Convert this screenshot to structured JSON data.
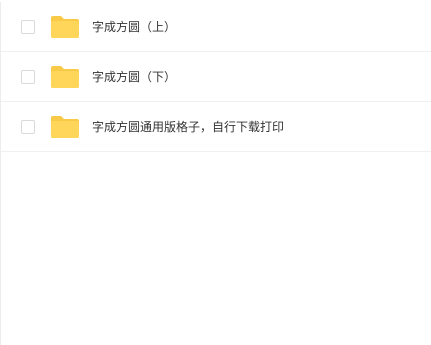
{
  "colors": {
    "folder_back": "#F9C948",
    "folder_front": "#FFD659",
    "row_divider": "#F0F0F0",
    "checkbox_border": "#D9D9D9",
    "text": "#333333"
  },
  "files": [
    {
      "name": "字成方圆（上）",
      "icon": "folder-icon",
      "checked": false
    },
    {
      "name": "字成方圆（下）",
      "icon": "folder-icon",
      "checked": false
    },
    {
      "name": "字成方圆通用版格子，自行下载打印",
      "icon": "folder-icon",
      "checked": false
    }
  ]
}
